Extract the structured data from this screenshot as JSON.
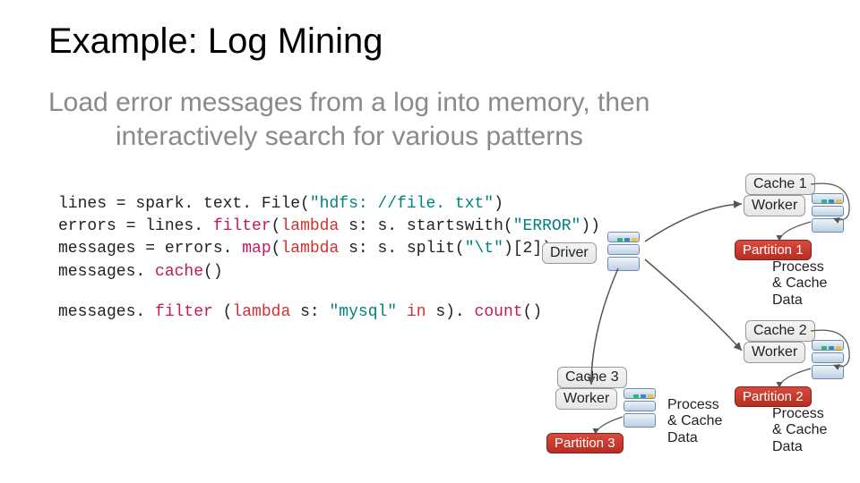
{
  "title": "Example: Log Mining",
  "subtitle_line1": "Load error messages from a log into memory, then",
  "subtitle_line2": "interactively search for various patterns",
  "code": {
    "l1a": "lines = spark. text. File(",
    "l1b": "\"hdfs: //file. txt\"",
    "l1c": ")",
    "l2a": "errors = lines.",
    "l2b": " filter",
    "l2c": "(",
    "l2d": "lambda",
    "l2e": " s: s. startswith(",
    "l2f": "\"ERROR\"",
    "l2g": "))",
    "l3a": "messages = errors.",
    "l3b": " map",
    "l3c": "(",
    "l3d": "lambda",
    "l3e": " s: s. split(",
    "l3f": "\"\\t\"",
    "l3g": ")[2])",
    "l4a": "messages.",
    "l4b": " cache",
    "l4c": "()",
    "l5a": "messages.",
    "l5b": " filter",
    "l5c": " (",
    "l5d": "lambda",
    "l5e": " s: ",
    "l5f": "\"mysql\"",
    "l5g": " in",
    "l5h": " s).",
    "l5i": " count",
    "l5j": "()"
  },
  "driver_label": "Driver",
  "worker_label": "Worker",
  "cache_labels": [
    "Cache 1",
    "Cache 2",
    "Cache 3"
  ],
  "partition_labels": [
    "Partition 1",
    "Partition 2",
    "Partition 3"
  ],
  "process_text_l1": "Process",
  "process_text_l2": "& Cache",
  "process_text_l3": "Data"
}
